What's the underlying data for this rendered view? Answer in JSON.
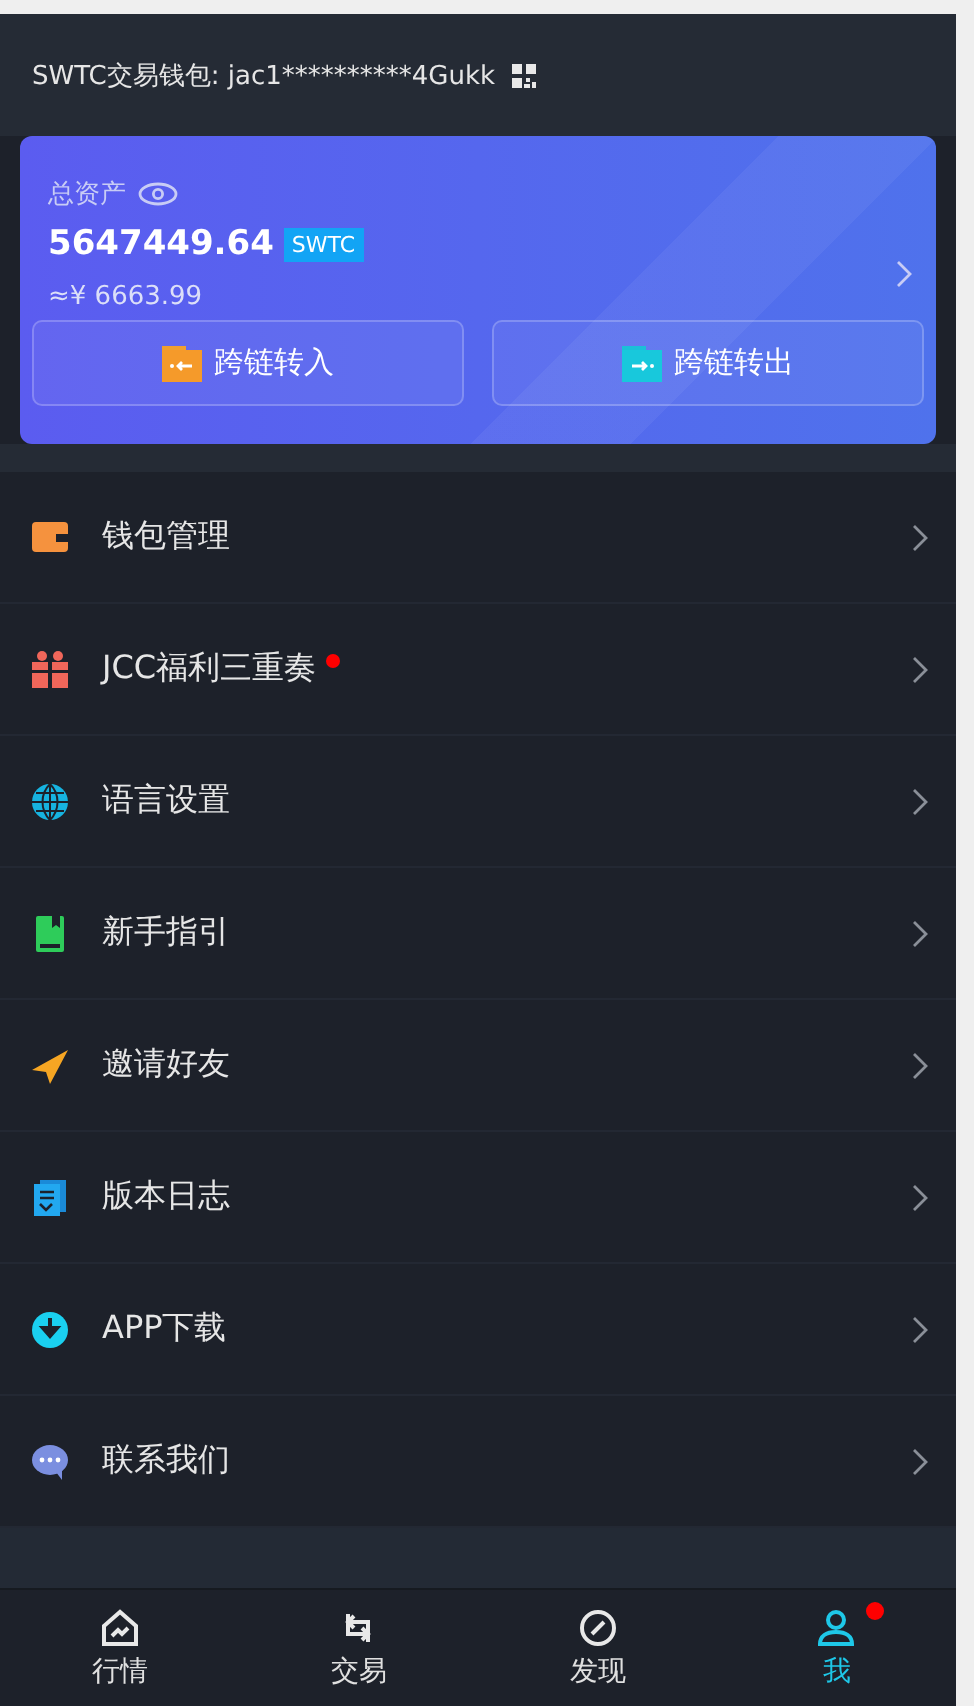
{
  "header": {
    "wallet_label": "SWTC交易钱包: jac1**********4Gukk"
  },
  "assets": {
    "label": "总资产",
    "amount": "5647449.64",
    "currency": "SWTC",
    "approx": "≈¥ 6663.99",
    "buttons": [
      {
        "kind": "in",
        "label": "跨链转入"
      },
      {
        "kind": "out",
        "label": "跨链转出"
      }
    ]
  },
  "menu": [
    {
      "kind": "wallet",
      "label": "钱包管理",
      "badge": false
    },
    {
      "kind": "gift",
      "label": "JCC福利三重奏",
      "badge": true
    },
    {
      "kind": "globe",
      "label": "语言设置",
      "badge": false
    },
    {
      "kind": "book",
      "label": "新手指引",
      "badge": false
    },
    {
      "kind": "plane",
      "label": "邀请好友",
      "badge": false
    },
    {
      "kind": "log",
      "label": "版本日志",
      "badge": false
    },
    {
      "kind": "download",
      "label": "APP下载",
      "badge": false
    },
    {
      "kind": "chat",
      "label": "联系我们",
      "badge": false
    }
  ],
  "tabs": [
    {
      "kind": "market",
      "label": "行情",
      "selected": false,
      "badge": false
    },
    {
      "kind": "trade",
      "label": "交易",
      "selected": false,
      "badge": false
    },
    {
      "kind": "discover",
      "label": "发现",
      "selected": false,
      "badge": false
    },
    {
      "kind": "me",
      "label": "我",
      "selected": true,
      "badge": true
    }
  ]
}
